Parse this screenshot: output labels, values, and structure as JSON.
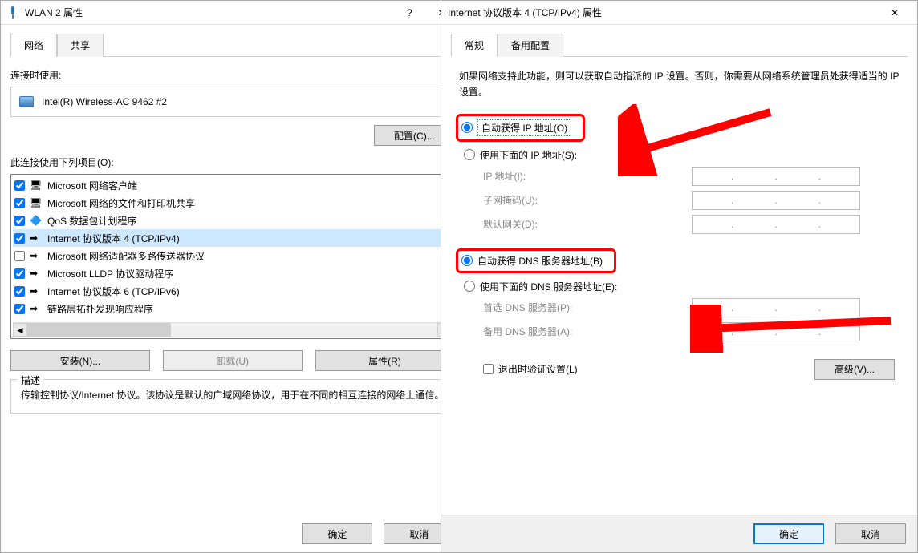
{
  "left": {
    "title": "WLAN 2 属性",
    "tabs": {
      "network": "网络",
      "sharing": "共享"
    },
    "connect_using_label": "连接时使用:",
    "adapter_name": "Intel(R) Wireless-AC 9462 #2",
    "configure_btn": "配置(C)...",
    "items_label": "此连接使用下列项目(O):",
    "items": [
      {
        "checked": true,
        "icon": "🖥",
        "label": "Microsoft 网络客户端"
      },
      {
        "checked": true,
        "icon": "🖥",
        "label": "Microsoft 网络的文件和打印机共享"
      },
      {
        "checked": true,
        "icon": "🔷",
        "label": "QoS 数据包计划程序"
      },
      {
        "checked": true,
        "icon": "➡",
        "label": "Internet 协议版本 4 (TCP/IPv4)",
        "selected": true
      },
      {
        "checked": false,
        "icon": "➡",
        "label": "Microsoft 网络适配器多路传送器协议"
      },
      {
        "checked": true,
        "icon": "➡",
        "label": "Microsoft LLDP 协议驱动程序"
      },
      {
        "checked": true,
        "icon": "➡",
        "label": "Internet 协议版本 6 (TCP/IPv6)"
      },
      {
        "checked": true,
        "icon": "➡",
        "label": "链路层拓扑发现响应程序"
      }
    ],
    "install_btn": "安装(N)...",
    "uninstall_btn": "卸载(U)",
    "properties_btn": "属性(R)",
    "desc_legend": "描述",
    "desc_text": "传输控制协议/Internet 协议。该协议是默认的广域网络协议，用于在不同的相互连接的网络上通信。",
    "ok_btn": "确定",
    "cancel_btn": "取消"
  },
  "right": {
    "title": "Internet 协议版本 4 (TCP/IPv4) 属性",
    "tabs": {
      "general": "常规",
      "alt": "备用配置"
    },
    "info": "如果网络支持此功能，则可以获取自动指派的 IP 设置。否则，你需要从网络系统管理员处获得适当的 IP 设置。",
    "ip_auto": "自动获得 IP 地址(O)",
    "ip_manual": "使用下面的 IP 地址(S):",
    "ip_addr_lbl": "IP 地址(I):",
    "subnet_lbl": "子网掩码(U):",
    "gateway_lbl": "默认网关(D):",
    "dns_auto": "自动获得 DNS 服务器地址(B)",
    "dns_manual": "使用下面的 DNS 服务器地址(E):",
    "dns1_lbl": "首选 DNS 服务器(P):",
    "dns2_lbl": "备用 DNS 服务器(A):",
    "validate_lbl": "退出时验证设置(L)",
    "advanced_btn": "高级(V)...",
    "ok_btn": "确定",
    "cancel_btn": "取消"
  },
  "annotations": {
    "color": "#ff0000"
  }
}
